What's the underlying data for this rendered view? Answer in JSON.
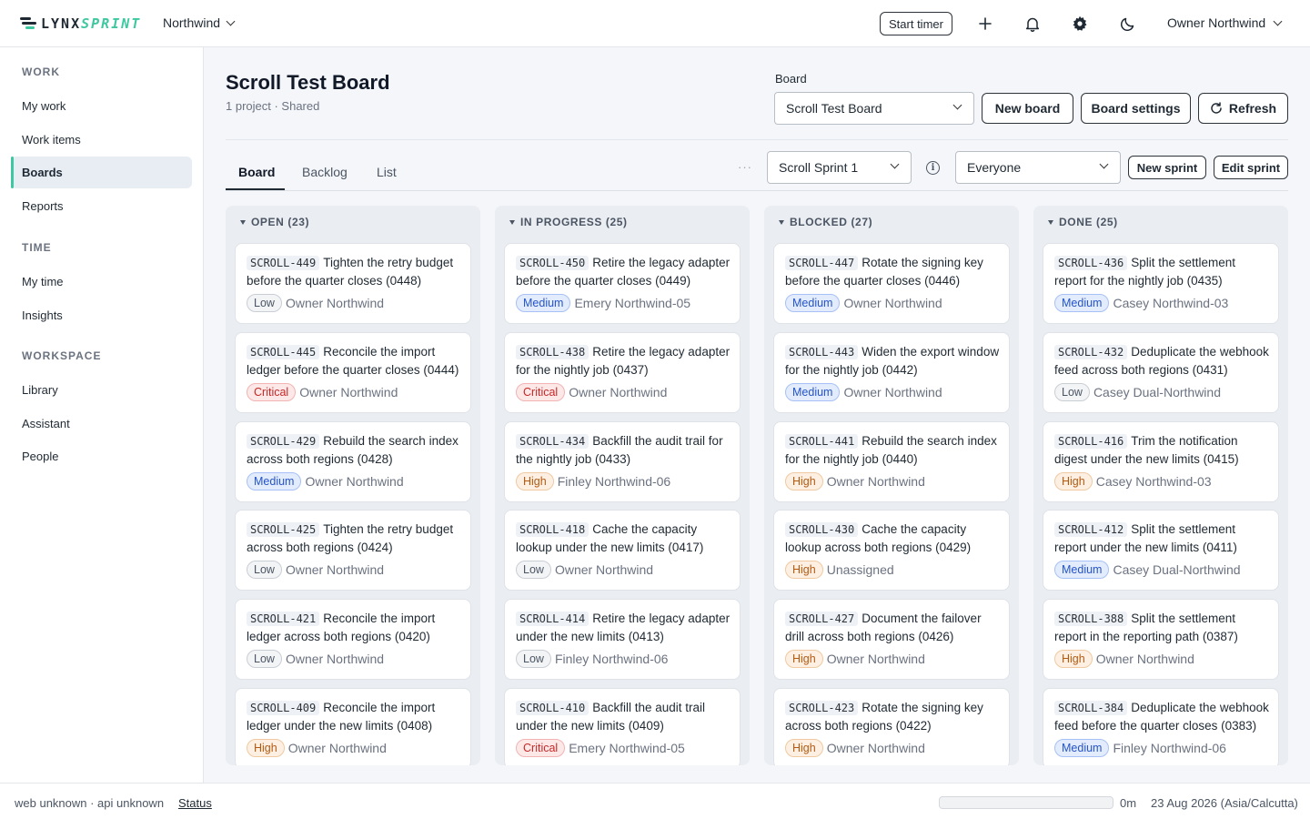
{
  "app": {
    "logo_main": "LYNX",
    "logo_accent": "SPRINT",
    "workspace": "Northwind",
    "start_timer": "Start timer",
    "user": "Owner Northwind",
    "icons": [
      "plus-icon",
      "bell-icon",
      "gear-icon",
      "moon-icon"
    ]
  },
  "sidebar": {
    "sections": [
      {
        "title": "WORK",
        "items": [
          {
            "label": "My work",
            "active": false
          },
          {
            "label": "Work items",
            "active": false
          },
          {
            "label": "Boards",
            "active": true
          },
          {
            "label": "Reports",
            "active": false
          }
        ]
      },
      {
        "title": "TIME",
        "items": [
          {
            "label": "My time",
            "active": false
          },
          {
            "label": "Insights",
            "active": false
          }
        ]
      },
      {
        "title": "WORKSPACE",
        "items": [
          {
            "label": "Library",
            "active": false
          },
          {
            "label": "Assistant",
            "active": false
          },
          {
            "label": "People",
            "active": false
          }
        ]
      }
    ]
  },
  "header": {
    "title": "Scroll Test Board",
    "subtitle": "1 project · Shared",
    "board_label": "Board",
    "board_select": "Scroll Test Board",
    "new_board": "New board",
    "board_settings": "Board settings",
    "refresh": "Refresh"
  },
  "tabs": [
    {
      "label": "Board",
      "active": true
    },
    {
      "label": "Backlog",
      "active": false
    },
    {
      "label": "List",
      "active": false
    }
  ],
  "toolbar": {
    "more": "···",
    "sprint_select": "Scroll Sprint 1",
    "info": "i",
    "assignee_select": "Everyone",
    "new_sprint": "New sprint",
    "edit_sprint": "Edit sprint"
  },
  "columns": [
    {
      "title": "OPEN (23)",
      "cards": [
        {
          "key": "SCROLL-449",
          "title": "Tighten the retry budget before the quarter closes (0448)",
          "priority": "Low",
          "assignee": "Owner Northwind"
        },
        {
          "key": "SCROLL-445",
          "title": "Reconcile the import ledger before the quarter closes (0444)",
          "priority": "Critical",
          "assignee": "Owner Northwind"
        },
        {
          "key": "SCROLL-429",
          "title": "Rebuild the search index across both regions (0428)",
          "priority": "Medium",
          "assignee": "Owner Northwind"
        },
        {
          "key": "SCROLL-425",
          "title": "Tighten the retry budget across both regions (0424)",
          "priority": "Low",
          "assignee": "Owner Northwind"
        },
        {
          "key": "SCROLL-421",
          "title": "Reconcile the import ledger across both regions (0420)",
          "priority": "Low",
          "assignee": "Owner Northwind"
        },
        {
          "key": "SCROLL-409",
          "title": "Reconcile the import ledger under the new limits (0408)",
          "priority": "High",
          "assignee": "Owner Northwind"
        }
      ]
    },
    {
      "title": "IN PROGRESS (25)",
      "cards": [
        {
          "key": "SCROLL-450",
          "title": "Retire the legacy adapter before the quarter closes (0449)",
          "priority": "Medium",
          "assignee": "Emery Northwind-05"
        },
        {
          "key": "SCROLL-438",
          "title": "Retire the legacy adapter for the nightly job (0437)",
          "priority": "Critical",
          "assignee": "Owner Northwind"
        },
        {
          "key": "SCROLL-434",
          "title": "Backfill the audit trail for the nightly job (0433)",
          "priority": "High",
          "assignee": "Finley Northwind-06"
        },
        {
          "key": "SCROLL-418",
          "title": "Cache the capacity lookup under the new limits (0417)",
          "priority": "Low",
          "assignee": "Owner Northwind"
        },
        {
          "key": "SCROLL-414",
          "title": "Retire the legacy adapter under the new limits (0413)",
          "priority": "Low",
          "assignee": "Finley Northwind-06"
        },
        {
          "key": "SCROLL-410",
          "title": "Backfill the audit trail under the new limits (0409)",
          "priority": "Critical",
          "assignee": "Emery Northwind-05"
        }
      ]
    },
    {
      "title": "BLOCKED (27)",
      "cards": [
        {
          "key": "SCROLL-447",
          "title": "Rotate the signing key before the quarter closes (0446)",
          "priority": "Medium",
          "assignee": "Owner Northwind"
        },
        {
          "key": "SCROLL-443",
          "title": "Widen the export window for the nightly job (0442)",
          "priority": "Medium",
          "assignee": "Owner Northwind"
        },
        {
          "key": "SCROLL-441",
          "title": "Rebuild the search index for the nightly job (0440)",
          "priority": "High",
          "assignee": "Owner Northwind"
        },
        {
          "key": "SCROLL-430",
          "title": "Cache the capacity lookup across both regions (0429)",
          "priority": "High",
          "assignee": "Unassigned"
        },
        {
          "key": "SCROLL-427",
          "title": "Document the failover drill across both regions (0426)",
          "priority": "High",
          "assignee": "Owner Northwind"
        },
        {
          "key": "SCROLL-423",
          "title": "Rotate the signing key across both regions (0422)",
          "priority": "High",
          "assignee": "Owner Northwind"
        }
      ]
    },
    {
      "title": "DONE (25)",
      "cards": [
        {
          "key": "SCROLL-436",
          "title": "Split the settlement report for the nightly job (0435)",
          "priority": "Medium",
          "assignee": "Casey Northwind-03"
        },
        {
          "key": "SCROLL-432",
          "title": "Deduplicate the webhook feed across both regions (0431)",
          "priority": "Low",
          "assignee": "Casey Dual-Northwind"
        },
        {
          "key": "SCROLL-416",
          "title": "Trim the notification digest under the new limits (0415)",
          "priority": "High",
          "assignee": "Casey Northwind-03"
        },
        {
          "key": "SCROLL-412",
          "title": "Split the settlement report under the new limits (0411)",
          "priority": "Medium",
          "assignee": "Casey Dual-Northwind"
        },
        {
          "key": "SCROLL-388",
          "title": "Split the settlement report in the reporting path (0387)",
          "priority": "High",
          "assignee": "Owner Northwind"
        },
        {
          "key": "SCROLL-384",
          "title": "Deduplicate the webhook feed before the quarter closes (0383)",
          "priority": "Medium",
          "assignee": "Finley Northwind-06"
        }
      ]
    }
  ],
  "footer": {
    "env": "web unknown · api unknown",
    "status": "Status",
    "timer_progress": 0,
    "timer_label": "0m",
    "date": "23 Aug 2026 (Asia/Calcutta)"
  },
  "colors": {
    "accent": "#3ec8a0",
    "low": "#4b5563",
    "medium": "#2554c7",
    "high": "#b35a12",
    "critical": "#c62828"
  }
}
